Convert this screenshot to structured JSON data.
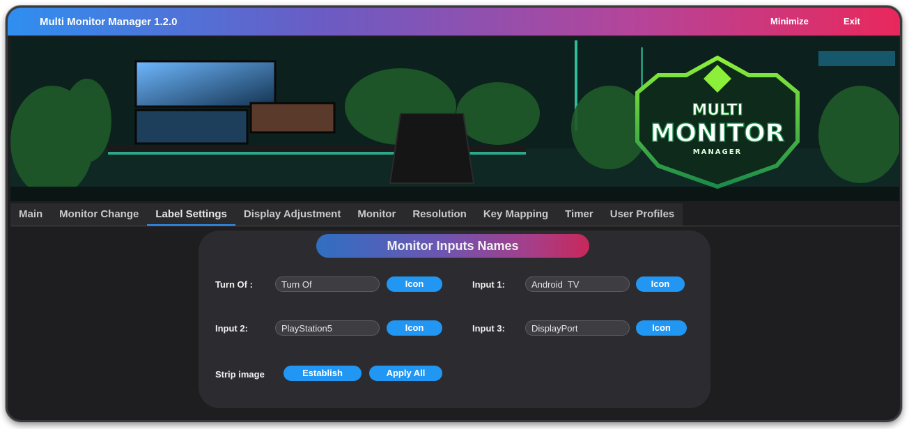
{
  "app": {
    "title": "Multi Monitor Manager 1.2.0",
    "minimize_label": "Minimize",
    "exit_label": "Exit"
  },
  "banner": {
    "logo_word_top": "MULTI",
    "logo_word_main": "MONITOR",
    "logo_word_bottom": "MANAGER"
  },
  "tabs": [
    {
      "label": "Main",
      "active": false
    },
    {
      "label": "Monitor Change",
      "active": false
    },
    {
      "label": "Label Settings",
      "active": true
    },
    {
      "label": "Display Adjustment",
      "active": false
    },
    {
      "label": "Monitor",
      "active": false
    },
    {
      "label": "Resolution",
      "active": false
    },
    {
      "label": "Key Mapping",
      "active": false
    },
    {
      "label": "Timer",
      "active": false
    },
    {
      "label": "User Profiles",
      "active": false
    }
  ],
  "panel": {
    "title": "Monitor Inputs Names",
    "rows": [
      {
        "label": "Turn Of :",
        "value": "Turn Of",
        "button": "Icon"
      },
      {
        "label": "Input 1:",
        "value": "Android  TV",
        "button": "Icon"
      },
      {
        "label": "Input 2:",
        "value": "PlayStation5",
        "button": "Icon"
      },
      {
        "label": "Input 3:",
        "value": "DisplayPort",
        "button": "Icon"
      }
    ],
    "strip": {
      "label": "Strip image",
      "establish_label": "Establish",
      "apply_all_label": "Apply All"
    }
  },
  "colors": {
    "accent": "#2196f3",
    "title_gradient_start": "#2f8ff0",
    "title_gradient_end": "#e8285c",
    "background": "#1e1e20",
    "panel": "#2c2c30"
  }
}
